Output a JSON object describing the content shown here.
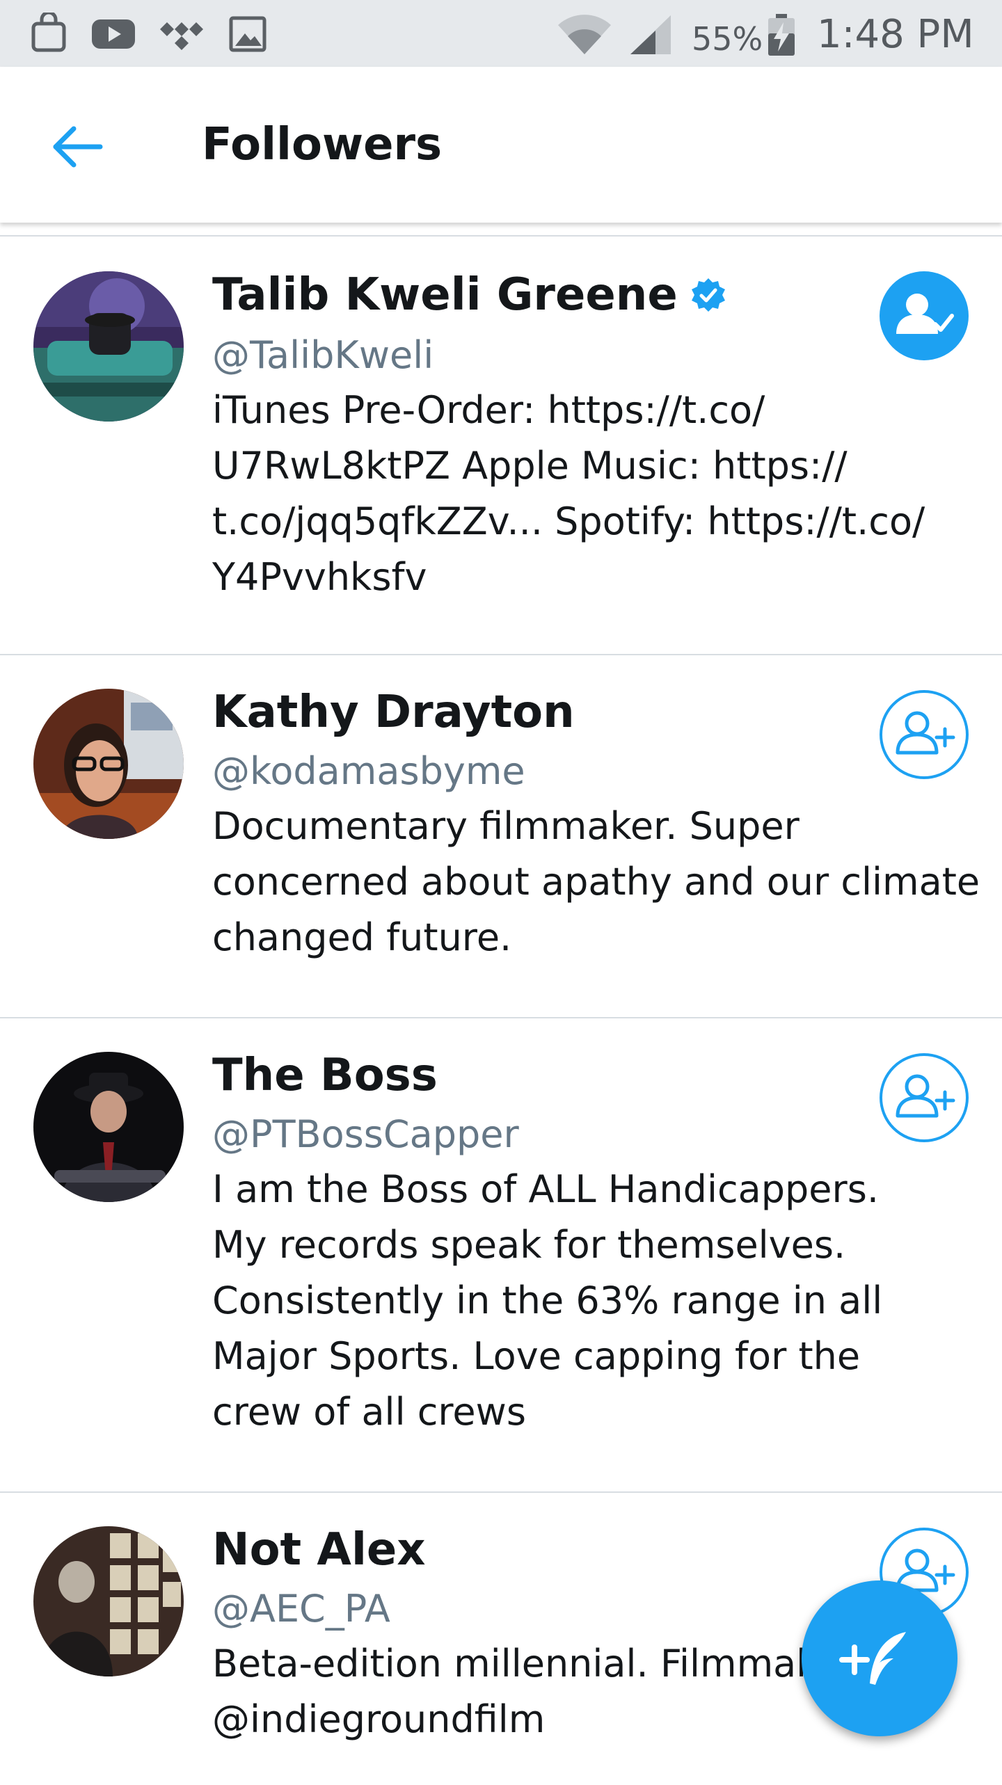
{
  "status_bar": {
    "icons": [
      "bag-icon",
      "youtube-icon",
      "tidal-icon",
      "image-icon",
      "wifi-icon",
      "signal-icon",
      "battery-charging-icon"
    ],
    "battery": "55%",
    "time": "1:48 PM"
  },
  "header": {
    "title": "Followers",
    "back_icon": "arrow-left-icon"
  },
  "colors": {
    "accent": "#1da1f2",
    "text_primary": "#14171a",
    "text_secondary": "#657786",
    "divider": "#d8dde2"
  },
  "followers": [
    {
      "name": "Talib Kweli Greene",
      "verified": true,
      "handle": "@TalibKweli",
      "bio_lines": [
        "iTunes Pre-Order: https://t.co/",
        "U7RwL8ktPZ Apple Music: https://",
        "t.co/jqq5qfkZZv... Spotify: https://t.co/",
        "Y4Pvvhksfv"
      ],
      "follow_state": "following",
      "follow_icon": "person-check-icon"
    },
    {
      "name": "Kathy Drayton",
      "verified": false,
      "handle": "@kodamasbyme",
      "bio_lines": [
        "Documentary filmmaker. Super",
        "concerned about apathy and our climate",
        "changed future."
      ],
      "follow_state": "not_following",
      "follow_icon": "person-add-icon"
    },
    {
      "name": "The Boss",
      "verified": false,
      "handle": "@PTBossCapper",
      "bio_lines": [
        "I am the Boss of ALL Handicappers.",
        "My records speak for themselves.",
        "Consistently in the 63% range in all",
        "Major Sports.  Love capping for the",
        "crew of all crews"
      ],
      "follow_state": "not_following",
      "follow_icon": "person-add-icon"
    },
    {
      "name": "Not Alex",
      "verified": false,
      "handle": "@AEC_PA",
      "bio_lines": [
        "Beta-edition millennial. Filmmak",
        "@indiegroundfilm"
      ],
      "follow_state": "not_following",
      "follow_icon": "person-add-icon"
    }
  ],
  "fab": {
    "icon": "compose-tweet-icon"
  }
}
